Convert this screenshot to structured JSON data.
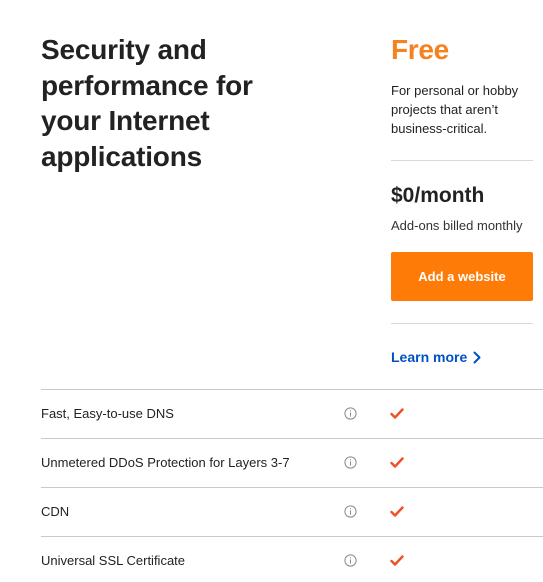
{
  "headline": {
    "line1": "Security and",
    "line2": "performance for",
    "line3": "your Internet",
    "line4": "applications"
  },
  "plan": {
    "name": "Free",
    "description": "For personal or hobby projects that aren’t business-critical.",
    "price": "$0/month",
    "price_note": "Add-ons billed monthly",
    "cta_label": "Add a website",
    "learn_more_label": "Learn more",
    "colors": {
      "accent": "#f6821f",
      "button": "#ff7b07",
      "link": "#0051c3",
      "check": "#f04e23"
    }
  },
  "features": [
    {
      "label": "Fast, Easy-to-use DNS",
      "icon": "info-icon",
      "included": true
    },
    {
      "label": "Unmetered DDoS Protection for Layers 3-7",
      "icon": "info-icon",
      "included": true
    },
    {
      "label": "CDN",
      "icon": "info-icon",
      "included": true
    },
    {
      "label": "Universal SSL Certificate",
      "icon": "info-icon",
      "included": true
    }
  ]
}
